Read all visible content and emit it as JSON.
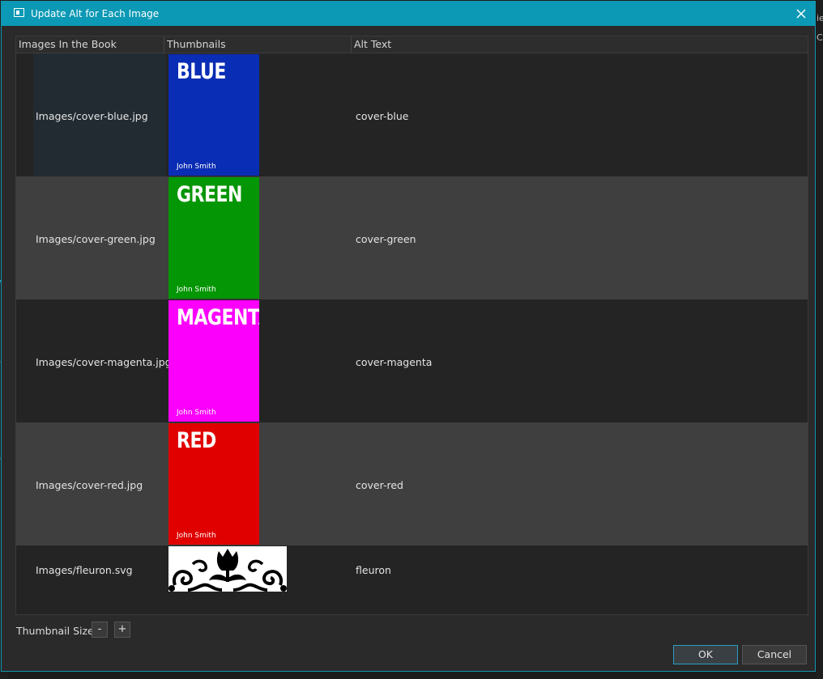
{
  "dialog": {
    "title": "Update Alt for Each Image"
  },
  "table": {
    "headers": {
      "images": "Images In the Book",
      "thumbnails": "Thumbnails",
      "alt": "Alt Text"
    },
    "rows": [
      {
        "path": "Images/cover-blue.jpg",
        "cover_title": "BLUE",
        "cover_author": "John Smith",
        "cover_color": "#0a2db5",
        "alt": "cover-blue"
      },
      {
        "path": "Images/cover-green.jpg",
        "cover_title": "GREEN",
        "cover_author": "John Smith",
        "cover_color": "#059605",
        "alt": "cover-green"
      },
      {
        "path": "Images/cover-magenta.jpg",
        "cover_title": "MAGENTA",
        "cover_author": "John Smith",
        "cover_color": "#fb00fb",
        "alt": "cover-magenta"
      },
      {
        "path": "Images/cover-red.jpg",
        "cover_title": "RED",
        "cover_author": "John Smith",
        "cover_color": "#e00000",
        "alt": "cover-red"
      },
      {
        "path": "Images/fleuron.svg",
        "alt": "fleuron"
      }
    ]
  },
  "footer": {
    "thumbnail_size_label": "Thumbnail Size",
    "decrease_label": "-",
    "increase_label": "+",
    "ok_label": "OK",
    "cancel_label": "Cancel"
  },
  "colors": {
    "titlebar": "#0b99b5",
    "row_dark": "#242424",
    "row_light": "#3f3f3f"
  }
}
